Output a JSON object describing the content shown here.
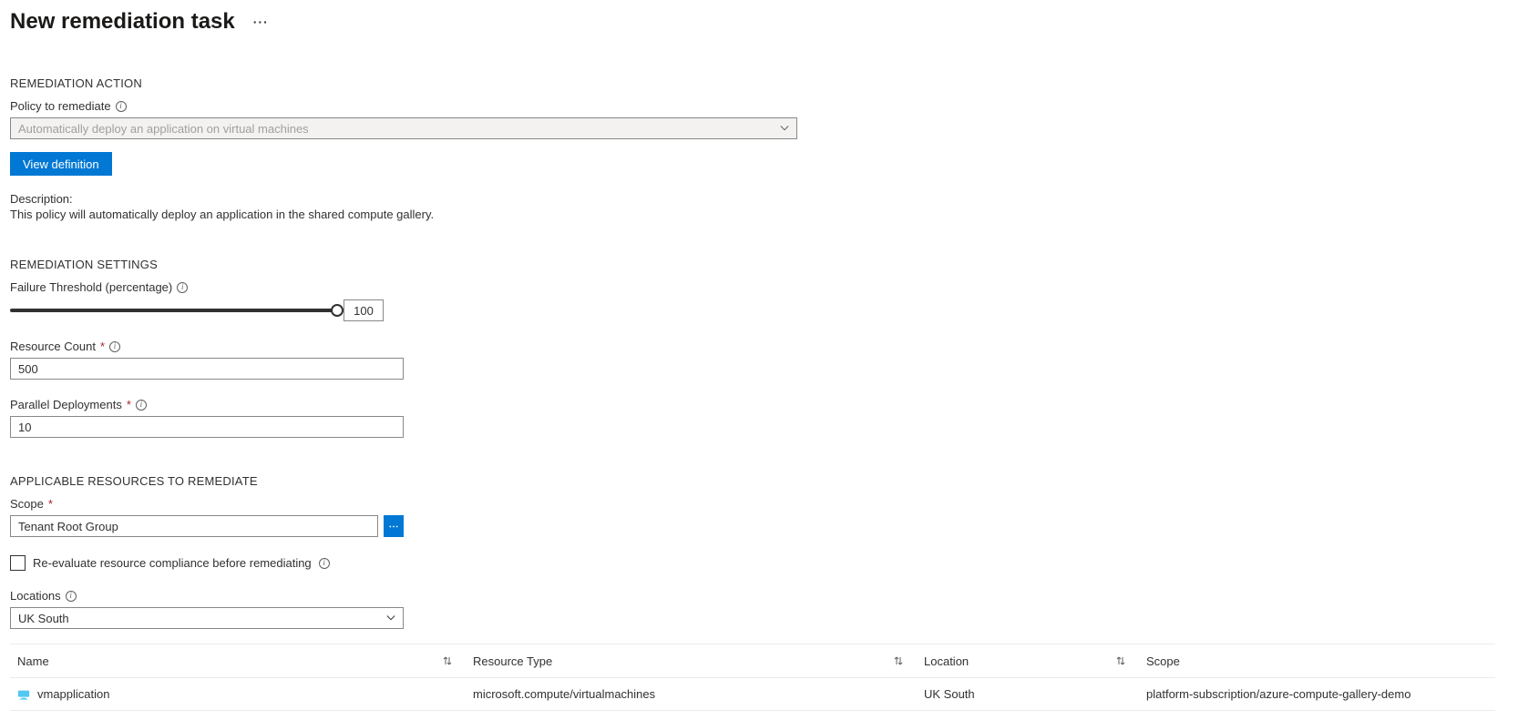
{
  "header": {
    "title": "New remediation task"
  },
  "sections": {
    "remediation_action": {
      "heading": "REMEDIATION ACTION",
      "policy_label": "Policy to remediate",
      "policy_value": "Automatically deploy an application on virtual machines",
      "view_definition": "View definition",
      "description_label": "Description:",
      "description_text": "This policy will automatically deploy an application in the shared compute gallery."
    },
    "remediation_settings": {
      "heading": "REMEDIATION SETTINGS",
      "failure_threshold_label": "Failure Threshold (percentage)",
      "failure_threshold_value": "100",
      "resource_count_label": "Resource Count",
      "resource_count_value": "500",
      "parallel_deployments_label": "Parallel Deployments",
      "parallel_deployments_value": "10"
    },
    "applicable_resources": {
      "heading": "APPLICABLE RESOURCES TO REMEDIATE",
      "scope_label": "Scope",
      "scope_value": "Tenant Root Group",
      "reevaluate_label": "Re-evaluate resource compliance before remediating",
      "locations_label": "Locations",
      "locations_value": "UK South"
    }
  },
  "table": {
    "columns": {
      "name": "Name",
      "type": "Resource Type",
      "location": "Location",
      "scope": "Scope"
    },
    "rows": [
      {
        "name": "vmapplication",
        "type": "microsoft.compute/virtualmachines",
        "location": "UK South",
        "scope": "platform-subscription/azure-compute-gallery-demo"
      }
    ]
  }
}
